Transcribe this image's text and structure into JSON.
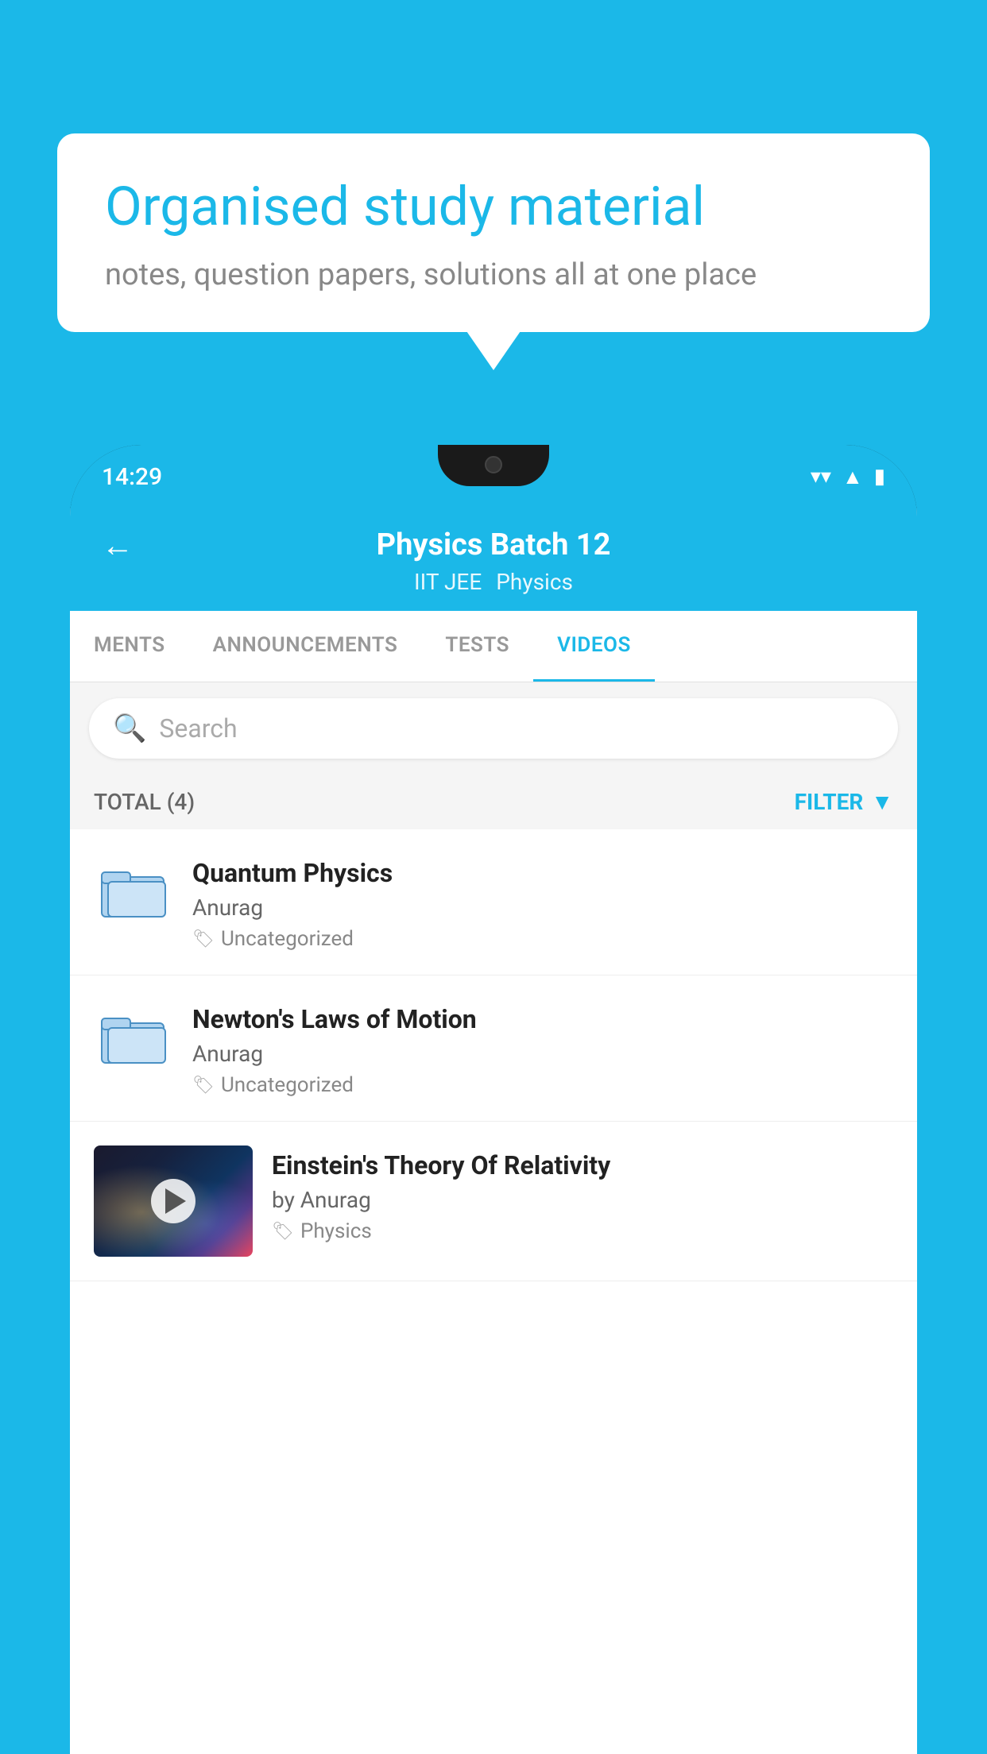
{
  "background_color": "#1bb8e8",
  "speech_bubble": {
    "title": "Organised study material",
    "subtitle": "notes, question papers, solutions all at one place"
  },
  "phone": {
    "status_bar": {
      "time": "14:29"
    },
    "app_header": {
      "title": "Physics Batch 12",
      "subtitle_parts": [
        "IIT JEE",
        "Physics"
      ],
      "back_label": "←"
    },
    "tabs": [
      {
        "label": "MENTS",
        "active": false
      },
      {
        "label": "ANNOUNCEMENTS",
        "active": false
      },
      {
        "label": "TESTS",
        "active": false
      },
      {
        "label": "VIDEOS",
        "active": true
      }
    ],
    "search": {
      "placeholder": "Search"
    },
    "filter_bar": {
      "total_label": "TOTAL (4)",
      "filter_label": "FILTER"
    },
    "videos": [
      {
        "id": 1,
        "title": "Quantum Physics",
        "author": "Anurag",
        "tag": "Uncategorized",
        "has_thumbnail": false
      },
      {
        "id": 2,
        "title": "Newton's Laws of Motion",
        "author": "Anurag",
        "tag": "Uncategorized",
        "has_thumbnail": false
      },
      {
        "id": 3,
        "title": "Einstein's Theory Of Relativity",
        "author": "by Anurag",
        "tag": "Physics",
        "has_thumbnail": true
      }
    ]
  }
}
